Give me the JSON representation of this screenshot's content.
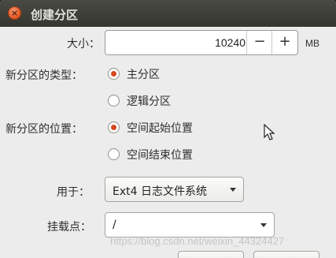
{
  "window": {
    "title": "创建分区"
  },
  "size": {
    "label": "大小：",
    "value": "10240",
    "minus": "−",
    "plus": "+",
    "unit": "MB"
  },
  "partition_type": {
    "label": "新分区的类型：",
    "options": [
      {
        "label": "主分区",
        "checked": true
      },
      {
        "label": "逻辑分区",
        "checked": false
      }
    ]
  },
  "partition_location": {
    "label": "新分区的位置：",
    "options": [
      {
        "label": "空间起始位置",
        "checked": true
      },
      {
        "label": "空间结束位置",
        "checked": false
      }
    ]
  },
  "use_as": {
    "label": "用于：",
    "value": "Ext4 日志文件系统"
  },
  "mount_point": {
    "label": "挂载点：",
    "value": "/"
  },
  "watermark": "https://blog.csdn.net/weixin_44324427",
  "icons": {
    "close": "close-icon",
    "dropdown": "chevron-down-icon",
    "cursor": "mouse-pointer-icon"
  },
  "colors": {
    "accent": "#d2491e",
    "titlebar": "#3c3c36",
    "background": "#ececec"
  }
}
